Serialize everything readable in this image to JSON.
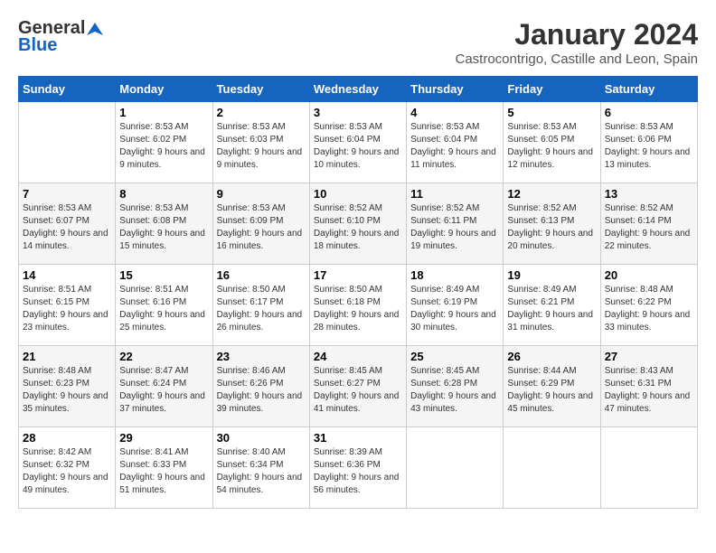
{
  "logo": {
    "general": "General",
    "blue": "Blue"
  },
  "title": "January 2024",
  "subtitle": "Castrocontrigo, Castille and Leon, Spain",
  "days_of_week": [
    "Sunday",
    "Monday",
    "Tuesday",
    "Wednesday",
    "Thursday",
    "Friday",
    "Saturday"
  ],
  "weeks": [
    [
      {
        "day": "",
        "sunrise": "",
        "sunset": "",
        "daylight": ""
      },
      {
        "day": "1",
        "sunrise": "Sunrise: 8:53 AM",
        "sunset": "Sunset: 6:02 PM",
        "daylight": "Daylight: 9 hours and 9 minutes."
      },
      {
        "day": "2",
        "sunrise": "Sunrise: 8:53 AM",
        "sunset": "Sunset: 6:03 PM",
        "daylight": "Daylight: 9 hours and 9 minutes."
      },
      {
        "day": "3",
        "sunrise": "Sunrise: 8:53 AM",
        "sunset": "Sunset: 6:04 PM",
        "daylight": "Daylight: 9 hours and 10 minutes."
      },
      {
        "day": "4",
        "sunrise": "Sunrise: 8:53 AM",
        "sunset": "Sunset: 6:04 PM",
        "daylight": "Daylight: 9 hours and 11 minutes."
      },
      {
        "day": "5",
        "sunrise": "Sunrise: 8:53 AM",
        "sunset": "Sunset: 6:05 PM",
        "daylight": "Daylight: 9 hours and 12 minutes."
      },
      {
        "day": "6",
        "sunrise": "Sunrise: 8:53 AM",
        "sunset": "Sunset: 6:06 PM",
        "daylight": "Daylight: 9 hours and 13 minutes."
      }
    ],
    [
      {
        "day": "7",
        "sunrise": "Sunrise: 8:53 AM",
        "sunset": "Sunset: 6:07 PM",
        "daylight": "Daylight: 9 hours and 14 minutes."
      },
      {
        "day": "8",
        "sunrise": "Sunrise: 8:53 AM",
        "sunset": "Sunset: 6:08 PM",
        "daylight": "Daylight: 9 hours and 15 minutes."
      },
      {
        "day": "9",
        "sunrise": "Sunrise: 8:53 AM",
        "sunset": "Sunset: 6:09 PM",
        "daylight": "Daylight: 9 hours and 16 minutes."
      },
      {
        "day": "10",
        "sunrise": "Sunrise: 8:52 AM",
        "sunset": "Sunset: 6:10 PM",
        "daylight": "Daylight: 9 hours and 18 minutes."
      },
      {
        "day": "11",
        "sunrise": "Sunrise: 8:52 AM",
        "sunset": "Sunset: 6:11 PM",
        "daylight": "Daylight: 9 hours and 19 minutes."
      },
      {
        "day": "12",
        "sunrise": "Sunrise: 8:52 AM",
        "sunset": "Sunset: 6:13 PM",
        "daylight": "Daylight: 9 hours and 20 minutes."
      },
      {
        "day": "13",
        "sunrise": "Sunrise: 8:52 AM",
        "sunset": "Sunset: 6:14 PM",
        "daylight": "Daylight: 9 hours and 22 minutes."
      }
    ],
    [
      {
        "day": "14",
        "sunrise": "Sunrise: 8:51 AM",
        "sunset": "Sunset: 6:15 PM",
        "daylight": "Daylight: 9 hours and 23 minutes."
      },
      {
        "day": "15",
        "sunrise": "Sunrise: 8:51 AM",
        "sunset": "Sunset: 6:16 PM",
        "daylight": "Daylight: 9 hours and 25 minutes."
      },
      {
        "day": "16",
        "sunrise": "Sunrise: 8:50 AM",
        "sunset": "Sunset: 6:17 PM",
        "daylight": "Daylight: 9 hours and 26 minutes."
      },
      {
        "day": "17",
        "sunrise": "Sunrise: 8:50 AM",
        "sunset": "Sunset: 6:18 PM",
        "daylight": "Daylight: 9 hours and 28 minutes."
      },
      {
        "day": "18",
        "sunrise": "Sunrise: 8:49 AM",
        "sunset": "Sunset: 6:19 PM",
        "daylight": "Daylight: 9 hours and 30 minutes."
      },
      {
        "day": "19",
        "sunrise": "Sunrise: 8:49 AM",
        "sunset": "Sunset: 6:21 PM",
        "daylight": "Daylight: 9 hours and 31 minutes."
      },
      {
        "day": "20",
        "sunrise": "Sunrise: 8:48 AM",
        "sunset": "Sunset: 6:22 PM",
        "daylight": "Daylight: 9 hours and 33 minutes."
      }
    ],
    [
      {
        "day": "21",
        "sunrise": "Sunrise: 8:48 AM",
        "sunset": "Sunset: 6:23 PM",
        "daylight": "Daylight: 9 hours and 35 minutes."
      },
      {
        "day": "22",
        "sunrise": "Sunrise: 8:47 AM",
        "sunset": "Sunset: 6:24 PM",
        "daylight": "Daylight: 9 hours and 37 minutes."
      },
      {
        "day": "23",
        "sunrise": "Sunrise: 8:46 AM",
        "sunset": "Sunset: 6:26 PM",
        "daylight": "Daylight: 9 hours and 39 minutes."
      },
      {
        "day": "24",
        "sunrise": "Sunrise: 8:45 AM",
        "sunset": "Sunset: 6:27 PM",
        "daylight": "Daylight: 9 hours and 41 minutes."
      },
      {
        "day": "25",
        "sunrise": "Sunrise: 8:45 AM",
        "sunset": "Sunset: 6:28 PM",
        "daylight": "Daylight: 9 hours and 43 minutes."
      },
      {
        "day": "26",
        "sunrise": "Sunrise: 8:44 AM",
        "sunset": "Sunset: 6:29 PM",
        "daylight": "Daylight: 9 hours and 45 minutes."
      },
      {
        "day": "27",
        "sunrise": "Sunrise: 8:43 AM",
        "sunset": "Sunset: 6:31 PM",
        "daylight": "Daylight: 9 hours and 47 minutes."
      }
    ],
    [
      {
        "day": "28",
        "sunrise": "Sunrise: 8:42 AM",
        "sunset": "Sunset: 6:32 PM",
        "daylight": "Daylight: 9 hours and 49 minutes."
      },
      {
        "day": "29",
        "sunrise": "Sunrise: 8:41 AM",
        "sunset": "Sunset: 6:33 PM",
        "daylight": "Daylight: 9 hours and 51 minutes."
      },
      {
        "day": "30",
        "sunrise": "Sunrise: 8:40 AM",
        "sunset": "Sunset: 6:34 PM",
        "daylight": "Daylight: 9 hours and 54 minutes."
      },
      {
        "day": "31",
        "sunrise": "Sunrise: 8:39 AM",
        "sunset": "Sunset: 6:36 PM",
        "daylight": "Daylight: 9 hours and 56 minutes."
      },
      {
        "day": "",
        "sunrise": "",
        "sunset": "",
        "daylight": ""
      },
      {
        "day": "",
        "sunrise": "",
        "sunset": "",
        "daylight": ""
      },
      {
        "day": "",
        "sunrise": "",
        "sunset": "",
        "daylight": ""
      }
    ]
  ]
}
